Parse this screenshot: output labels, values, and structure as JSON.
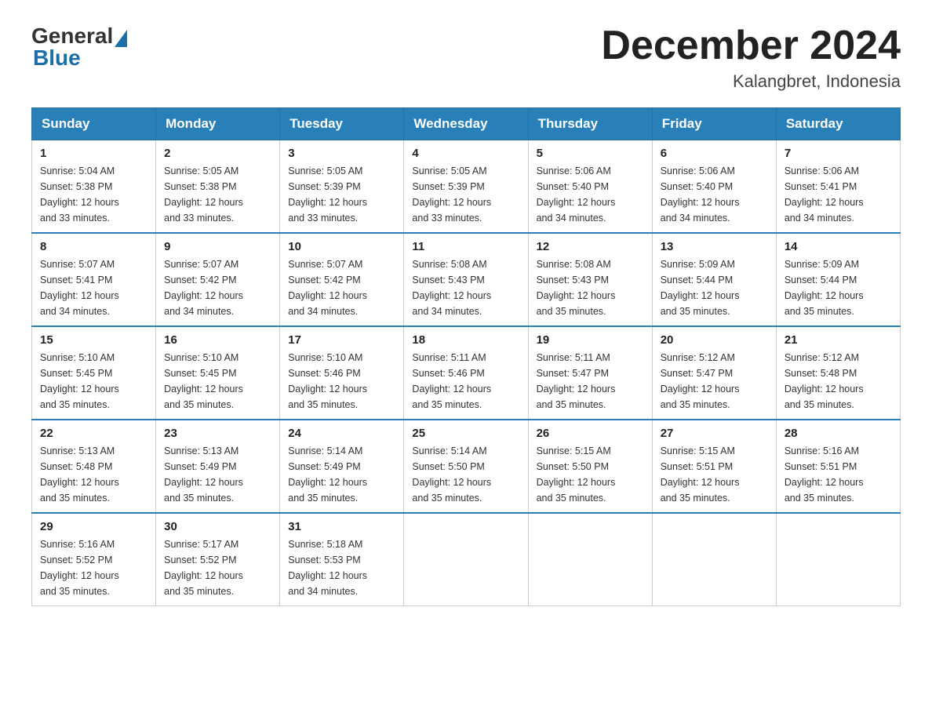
{
  "header": {
    "logo_general": "General",
    "logo_blue": "Blue",
    "month_title": "December 2024",
    "location": "Kalangbret, Indonesia"
  },
  "days_of_week": [
    "Sunday",
    "Monday",
    "Tuesday",
    "Wednesday",
    "Thursday",
    "Friday",
    "Saturday"
  ],
  "weeks": [
    [
      {
        "day": "1",
        "sunrise": "5:04 AM",
        "sunset": "5:38 PM",
        "daylight": "12 hours and 33 minutes."
      },
      {
        "day": "2",
        "sunrise": "5:05 AM",
        "sunset": "5:38 PM",
        "daylight": "12 hours and 33 minutes."
      },
      {
        "day": "3",
        "sunrise": "5:05 AM",
        "sunset": "5:39 PM",
        "daylight": "12 hours and 33 minutes."
      },
      {
        "day": "4",
        "sunrise": "5:05 AM",
        "sunset": "5:39 PM",
        "daylight": "12 hours and 33 minutes."
      },
      {
        "day": "5",
        "sunrise": "5:06 AM",
        "sunset": "5:40 PM",
        "daylight": "12 hours and 34 minutes."
      },
      {
        "day": "6",
        "sunrise": "5:06 AM",
        "sunset": "5:40 PM",
        "daylight": "12 hours and 34 minutes."
      },
      {
        "day": "7",
        "sunrise": "5:06 AM",
        "sunset": "5:41 PM",
        "daylight": "12 hours and 34 minutes."
      }
    ],
    [
      {
        "day": "8",
        "sunrise": "5:07 AM",
        "sunset": "5:41 PM",
        "daylight": "12 hours and 34 minutes."
      },
      {
        "day": "9",
        "sunrise": "5:07 AM",
        "sunset": "5:42 PM",
        "daylight": "12 hours and 34 minutes."
      },
      {
        "day": "10",
        "sunrise": "5:07 AM",
        "sunset": "5:42 PM",
        "daylight": "12 hours and 34 minutes."
      },
      {
        "day": "11",
        "sunrise": "5:08 AM",
        "sunset": "5:43 PM",
        "daylight": "12 hours and 34 minutes."
      },
      {
        "day": "12",
        "sunrise": "5:08 AM",
        "sunset": "5:43 PM",
        "daylight": "12 hours and 35 minutes."
      },
      {
        "day": "13",
        "sunrise": "5:09 AM",
        "sunset": "5:44 PM",
        "daylight": "12 hours and 35 minutes."
      },
      {
        "day": "14",
        "sunrise": "5:09 AM",
        "sunset": "5:44 PM",
        "daylight": "12 hours and 35 minutes."
      }
    ],
    [
      {
        "day": "15",
        "sunrise": "5:10 AM",
        "sunset": "5:45 PM",
        "daylight": "12 hours and 35 minutes."
      },
      {
        "day": "16",
        "sunrise": "5:10 AM",
        "sunset": "5:45 PM",
        "daylight": "12 hours and 35 minutes."
      },
      {
        "day": "17",
        "sunrise": "5:10 AM",
        "sunset": "5:46 PM",
        "daylight": "12 hours and 35 minutes."
      },
      {
        "day": "18",
        "sunrise": "5:11 AM",
        "sunset": "5:46 PM",
        "daylight": "12 hours and 35 minutes."
      },
      {
        "day": "19",
        "sunrise": "5:11 AM",
        "sunset": "5:47 PM",
        "daylight": "12 hours and 35 minutes."
      },
      {
        "day": "20",
        "sunrise": "5:12 AM",
        "sunset": "5:47 PM",
        "daylight": "12 hours and 35 minutes."
      },
      {
        "day": "21",
        "sunrise": "5:12 AM",
        "sunset": "5:48 PM",
        "daylight": "12 hours and 35 minutes."
      }
    ],
    [
      {
        "day": "22",
        "sunrise": "5:13 AM",
        "sunset": "5:48 PM",
        "daylight": "12 hours and 35 minutes."
      },
      {
        "day": "23",
        "sunrise": "5:13 AM",
        "sunset": "5:49 PM",
        "daylight": "12 hours and 35 minutes."
      },
      {
        "day": "24",
        "sunrise": "5:14 AM",
        "sunset": "5:49 PM",
        "daylight": "12 hours and 35 minutes."
      },
      {
        "day": "25",
        "sunrise": "5:14 AM",
        "sunset": "5:50 PM",
        "daylight": "12 hours and 35 minutes."
      },
      {
        "day": "26",
        "sunrise": "5:15 AM",
        "sunset": "5:50 PM",
        "daylight": "12 hours and 35 minutes."
      },
      {
        "day": "27",
        "sunrise": "5:15 AM",
        "sunset": "5:51 PM",
        "daylight": "12 hours and 35 minutes."
      },
      {
        "day": "28",
        "sunrise": "5:16 AM",
        "sunset": "5:51 PM",
        "daylight": "12 hours and 35 minutes."
      }
    ],
    [
      {
        "day": "29",
        "sunrise": "5:16 AM",
        "sunset": "5:52 PM",
        "daylight": "12 hours and 35 minutes."
      },
      {
        "day": "30",
        "sunrise": "5:17 AM",
        "sunset": "5:52 PM",
        "daylight": "12 hours and 35 minutes."
      },
      {
        "day": "31",
        "sunrise": "5:18 AM",
        "sunset": "5:53 PM",
        "daylight": "12 hours and 34 minutes."
      },
      null,
      null,
      null,
      null
    ]
  ],
  "labels": {
    "sunrise": "Sunrise:",
    "sunset": "Sunset:",
    "daylight": "Daylight:"
  },
  "accent_color": "#2980b9"
}
